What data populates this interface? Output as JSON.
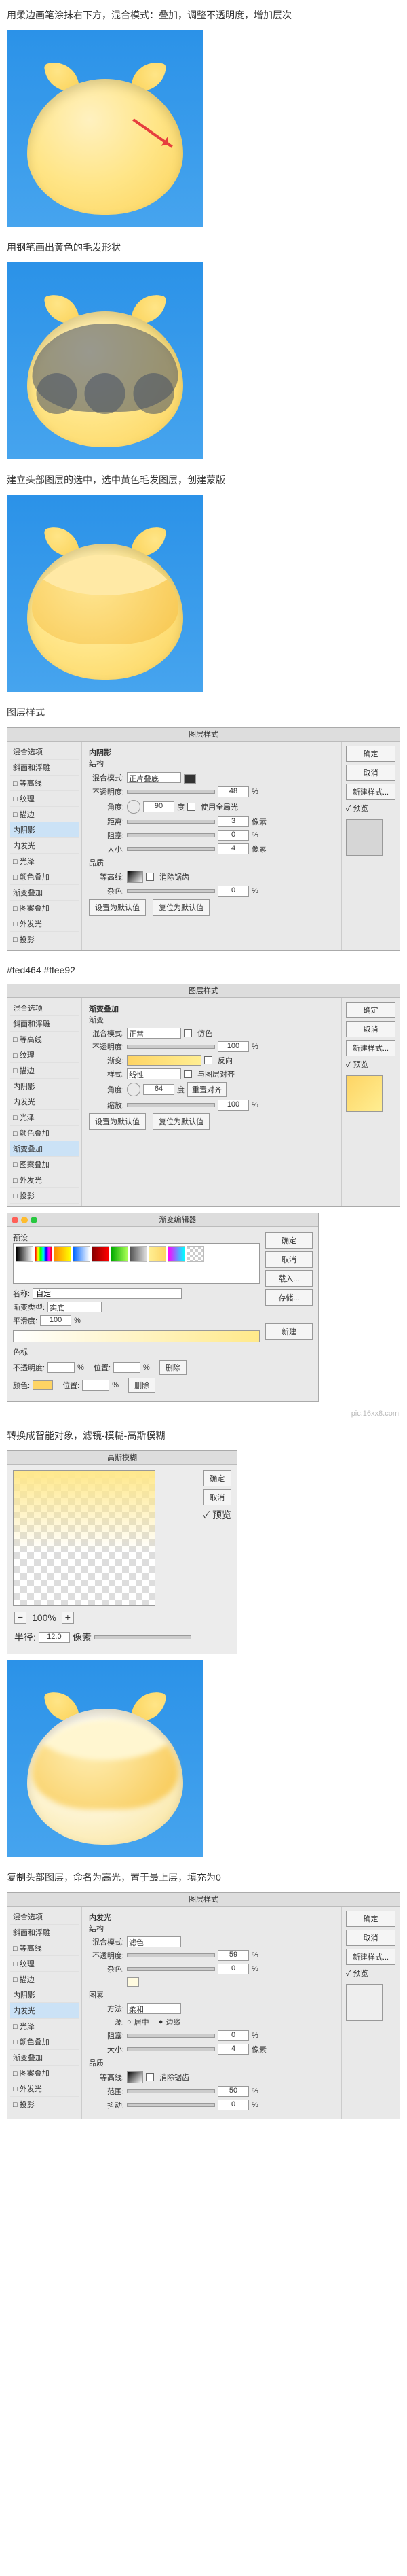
{
  "steps": {
    "s1": "用柔边画笔涂抹右下方，混合模式：叠加，调整不透明度，增加层次",
    "s2": "用钢笔画出黄色的毛发形状",
    "s3": "建立头部图层的选中，选中黄色毛发图层，创建蒙版",
    "s4": "图层样式",
    "s5": "#fed464  #ffee92",
    "s6": "转换成智能对象，滤镜-模糊-高斯模糊",
    "s7": "复制头部图层，命名为高光，置于最上层，填充为0"
  },
  "watermark": "pic.16xx8.com",
  "layerStylesTitle": "图层样式",
  "styleItems": {
    "blending": "混合选项",
    "bevel": "斜面和浮雕",
    "contourSub": "□ 等高线",
    "textureSub": "□ 纹理",
    "stroke": "□ 描边",
    "innerShadow": "内阴影",
    "innerGlow": "内发光",
    "satin": "□ 光泽",
    "colorOverlay": "□ 颜色叠加",
    "gradOverlay": "渐变叠加",
    "patternOverlay": "□ 图案叠加",
    "outerGlow": "□ 外发光",
    "dropShadow": "□ 投影"
  },
  "buttons": {
    "ok": "确定",
    "cancel": "取消",
    "newStyle": "新建样式...",
    "preview": "✓ 预览",
    "new": "新建",
    "save": "存储...",
    "delete": "删除"
  },
  "innerShadow": {
    "heading": "内阴影",
    "struct": "结构",
    "blendLabel": "混合模式:",
    "blendValue": "正片叠底",
    "opacityLabel": "不透明度:",
    "opacityValue": "48",
    "pct": "%",
    "angleLabel": "角度:",
    "angleValue": "90",
    "deg": "度",
    "globalLabel": "使用全局光",
    "distanceLabel": "距离:",
    "distanceValue": "3",
    "px": "像素",
    "chokeLabel": "阻塞:",
    "chokeValue": "0",
    "sizeLabel": "大小:",
    "sizeValue": "4",
    "quality": "品质",
    "contourLabel": "等高线:",
    "antiAliasLabel": "消除锯齿",
    "noiseLabel": "杂色:",
    "noiseValue": "0",
    "reset": "设置为默认值",
    "resetTo": "复位为默认值"
  },
  "gradOverlay": {
    "heading": "渐变叠加",
    "struct": "渐变",
    "blendLabel": "混合模式:",
    "blendValue": "正常",
    "ditherLabel": "仿色",
    "opacityLabel": "不透明度:",
    "opacityValue": "100",
    "pct": "%",
    "gradLabel": "渐变:",
    "reverseLabel": "反向",
    "styleLabel": "样式:",
    "styleValue": "线性",
    "alignLabel": "与图层对齐",
    "angleLabel": "角度:",
    "angleValue": "64",
    "deg": "度",
    "resetAlign": "重置对齐",
    "scaleLabel": "缩放:",
    "scaleValue": "100",
    "reset": "设置为默认值",
    "resetTo": "复位为默认值"
  },
  "gradEditor": {
    "title": "渐变编辑器",
    "presetsLabel": "预设",
    "nameLabel": "名称:",
    "nameValue": "自定",
    "typeLabel": "渐变类型:",
    "typeValue": "实底",
    "smoothLabel": "平滑度:",
    "smoothValue": "100",
    "pct": "%",
    "stopsLabel": "色标",
    "opacityLabel": "不透明度:",
    "posLabel": "位置:",
    "colorLabel": "颜色:",
    "deleteLabel": "删除"
  },
  "gauss": {
    "title": "高斯模糊",
    "zoomValue": "100%",
    "radiusLabel": "半径:",
    "radiusValue": "12.0",
    "px": "像素"
  },
  "innerGlow": {
    "heading": "内发光",
    "struct": "结构",
    "blendLabel": "混合模式:",
    "blendValue": "滤色",
    "opacityLabel": "不透明度:",
    "opacityValue": "59",
    "pct": "%",
    "noiseLabel": "杂色:",
    "noiseValue": "0",
    "elementsLabel": "图素",
    "methodLabel": "方法:",
    "methodValue": "柔和",
    "sourceLabel": "源:",
    "centerLabel": "居中",
    "edgeLabel": "边缘",
    "chokeLabel": "阻塞:",
    "chokeValue": "0",
    "sizeLabel": "大小:",
    "sizeValue": "4",
    "px": "像素",
    "quality": "品质",
    "contourLabel": "等高线:",
    "antiAliasLabel": "消除锯齿",
    "rangeLabel": "范围:",
    "rangeValue": "50",
    "jitterLabel": "抖动:",
    "jitterValue": "0"
  }
}
